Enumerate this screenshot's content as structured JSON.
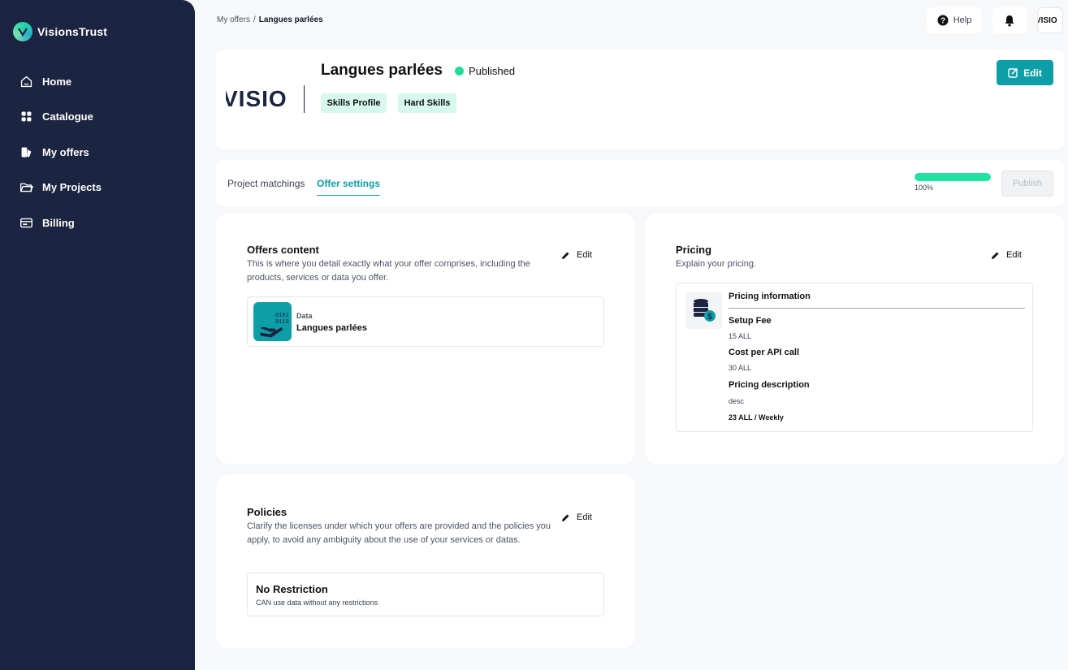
{
  "brand": {
    "name": "VisionsTrust"
  },
  "nav": {
    "items": [
      {
        "label": "Home",
        "icon": "home-icon"
      },
      {
        "label": "Catalogue",
        "icon": "grid-icon"
      },
      {
        "label": "My offers",
        "icon": "offers-icon"
      },
      {
        "label": "My Projects",
        "icon": "folder-icon"
      },
      {
        "label": "Billing",
        "icon": "billing-icon"
      }
    ]
  },
  "breadcrumb": {
    "parent": "My offers",
    "separator": "/",
    "current": "Langues parlées"
  },
  "topbar": {
    "help_label": "Help",
    "avatar_text": "VISIO"
  },
  "offer": {
    "logo_text": "VISIO",
    "title": "Langues parlées",
    "status": "Published",
    "tags": [
      "Skills Profile",
      "Hard Skills"
    ],
    "edit_label": "Edit"
  },
  "tabs": {
    "items": [
      {
        "label": "Project matchings",
        "active": false
      },
      {
        "label": "Offer settings",
        "active": true
      }
    ],
    "progress_percent": 100,
    "progress_label": "100%",
    "publish_label": "Publish"
  },
  "offers_content": {
    "title": "Offers content",
    "description": "This is where you detail exactly what your offer comprises, including the products, services or data you offer.",
    "edit_label": "Edit",
    "resource": {
      "icon_text_1": "0101",
      "icon_text_2": "0110",
      "type": "Data",
      "name": "Langues parlées"
    }
  },
  "pricing": {
    "title": "Pricing",
    "description": "Explain your pricing.",
    "edit_label": "Edit",
    "info_title": "Pricing information",
    "setup_fee_label": "Setup Fee",
    "setup_fee_value": "15 ALL",
    "api_call_label": "Cost per API call",
    "api_call_value": "30 ALL",
    "desc_label": "Pricing description",
    "desc_value": "desc",
    "recurring": "23 ALL / Weekly"
  },
  "policies": {
    "title": "Policies",
    "description": "Clarify the licenses under which your offers are provided and the policies you apply, to avoid any ambiguity about the use of your services or datas.",
    "edit_label": "Edit",
    "policy_title": "No Restriction",
    "policy_desc": "CAN use data without any restrictions"
  },
  "colors": {
    "sidebar": "#1b2440",
    "accent": "#0e9ea7",
    "status_green": "#1fdc97",
    "tag_bg": "#d7f8ee"
  }
}
